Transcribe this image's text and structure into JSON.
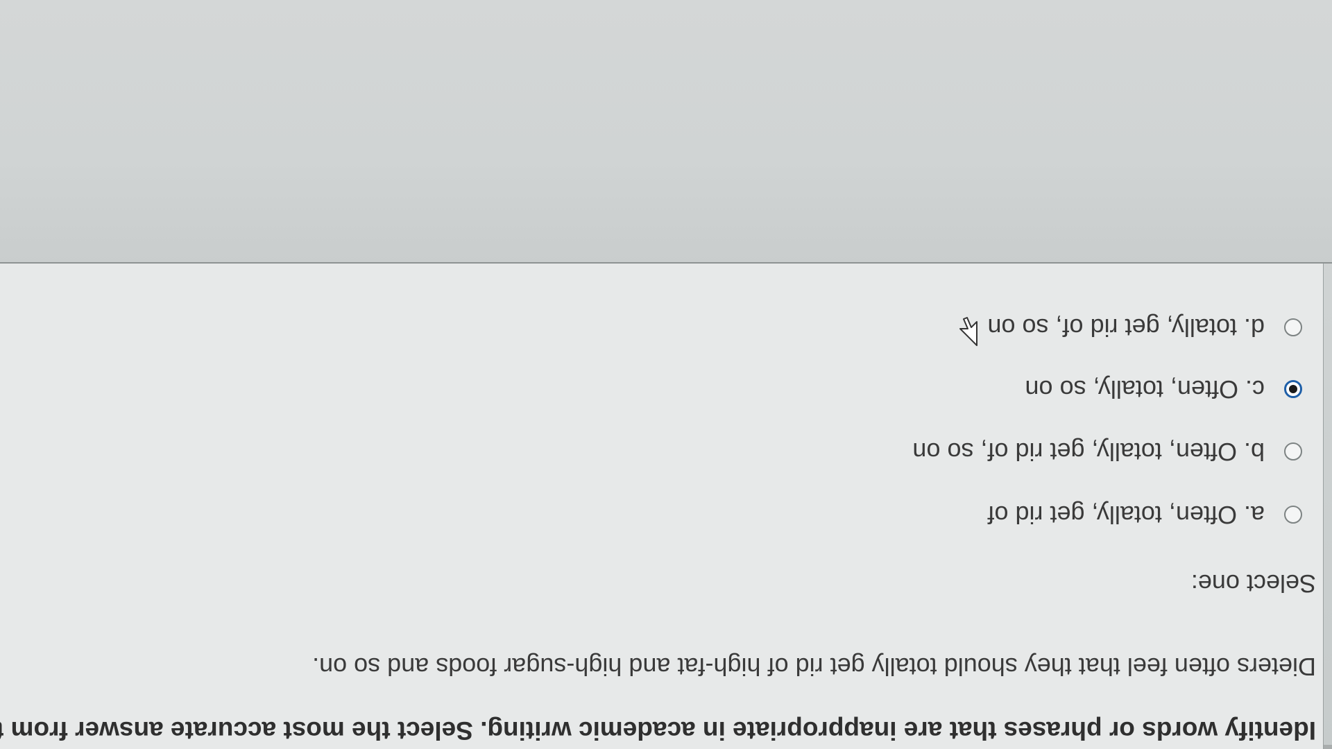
{
  "question": {
    "instruction": "Identify words or phrases that are inappropriate in academic writing. Select the most accurate answer from th",
    "sentence": "Dieters often feel that they should totally get rid of high-fat and high-sugar foods and so on.",
    "select_label": "Select one:",
    "options": [
      {
        "label": "a. Often, totally, get rid of",
        "selected": false
      },
      {
        "label": "b. Often, totally, get rid of, so on",
        "selected": false
      },
      {
        "label": "c. Often, totally, so on",
        "selected": true
      },
      {
        "label": "d. totally, get rid of, so on",
        "selected": false
      }
    ]
  },
  "colors": {
    "selected_radio_ring": "#1e5fa8",
    "selected_radio_dot": "#1a1a1a",
    "text": "#333333",
    "card_background": "#e7e9e9",
    "page_background": "#d0d4d4"
  },
  "icons": {
    "cursor": "arrow-cursor-icon",
    "radio_unselected": "radio-empty-icon",
    "radio_selected": "radio-filled-icon"
  }
}
